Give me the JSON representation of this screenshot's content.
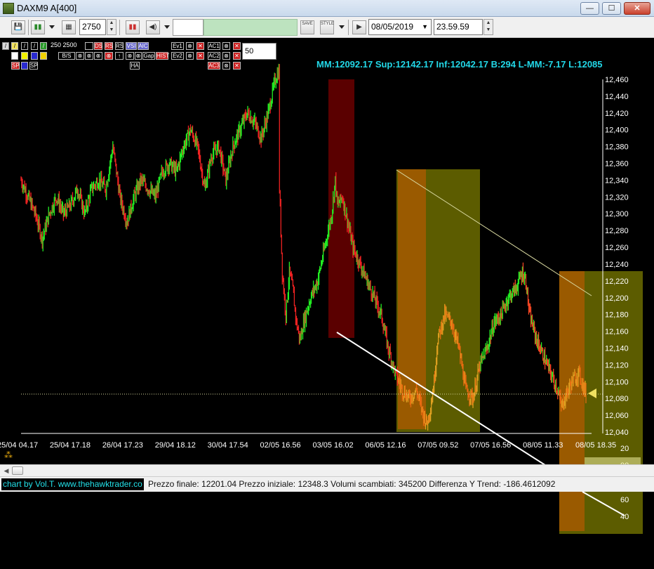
{
  "window": {
    "title": "DAXM9 A[400]",
    "min": "—",
    "max": "☐",
    "close": "✕"
  },
  "toolbar": {
    "quantity": "2750",
    "date": "08/05/2019",
    "time": "23.59.59",
    "save_label": "SAVE",
    "style_label": "STYLE"
  },
  "indicators": {
    "row1_nums": "250 2500",
    "row2": [
      "B/S",
      "VSI",
      "AIC",
      "Gap",
      "HIST",
      "Ev2",
      "AC2"
    ],
    "row1": [
      "DS",
      "RS",
      "RS",
      "VSI",
      "AIC",
      "Ev1",
      "AC1"
    ],
    "row3": [
      "SP",
      "SP",
      "HA",
      "AC3"
    ],
    "period": "50"
  },
  "info_line": "MM:12092.17 Sup:12142.17 Inf:12042.17 B:294 L-MM:-7.17 L:12085",
  "chart_data": {
    "type": "candlestick",
    "y_axis_labels": [
      "12,460",
      "12,440",
      "12,420",
      "12,400",
      "12,380",
      "12,360",
      "12,340",
      "12,320",
      "12,300",
      "12,280",
      "12,260",
      "12,240",
      "12,220",
      "12,200",
      "12,180",
      "12,160",
      "12,140",
      "12,120",
      "12,100",
      "12,080",
      "12,060",
      "12,040"
    ],
    "lower_axis_labels": [
      "20",
      "00",
      "80",
      "60",
      "40"
    ],
    "x_axis_labels": [
      "25/04 04.17",
      "25/04 17.18",
      "26/04 17.23",
      "29/04 18.12",
      "30/04 17.54",
      "02/05 16.56",
      "03/05 16.02",
      "06/05 12.16",
      "07/05 09.52",
      "07/05 16.56",
      "08/05 11.33",
      "08/05 18.35"
    ],
    "ylim": [
      12040,
      12460
    ],
    "last_price_level": 12085,
    "price_path": [
      [
        0,
        12340
      ],
      [
        10,
        12320
      ],
      [
        20,
        12300
      ],
      [
        30,
        12270
      ],
      [
        40,
        12300
      ],
      [
        50,
        12320
      ],
      [
        60,
        12300
      ],
      [
        70,
        12310
      ],
      [
        80,
        12330
      ],
      [
        90,
        12300
      ],
      [
        100,
        12330
      ],
      [
        110,
        12340
      ],
      [
        120,
        12330
      ],
      [
        130,
        12380
      ],
      [
        140,
        12320
      ],
      [
        150,
        12290
      ],
      [
        160,
        12320
      ],
      [
        170,
        12340
      ],
      [
        180,
        12330
      ],
      [
        190,
        12320
      ],
      [
        200,
        12350
      ],
      [
        210,
        12360
      ],
      [
        220,
        12350
      ],
      [
        230,
        12380
      ],
      [
        240,
        12400
      ],
      [
        250,
        12380
      ],
      [
        260,
        12330
      ],
      [
        270,
        12370
      ],
      [
        280,
        12380
      ],
      [
        290,
        12340
      ],
      [
        300,
        12380
      ],
      [
        310,
        12400
      ],
      [
        320,
        12420
      ],
      [
        330,
        12410
      ],
      [
        340,
        12390
      ],
      [
        350,
        12420
      ],
      [
        360,
        12460
      ],
      [
        365,
        12470
      ],
      [
        366,
        12330
      ],
      [
        370,
        12230
      ],
      [
        375,
        12180
      ],
      [
        380,
        12230
      ],
      [
        385,
        12210
      ],
      [
        390,
        12170
      ],
      [
        395,
        12150
      ],
      [
        400,
        12170
      ],
      [
        410,
        12200
      ],
      [
        420,
        12220
      ],
      [
        430,
        12260
      ],
      [
        440,
        12300
      ],
      [
        445,
        12340
      ],
      [
        448,
        12310
      ],
      [
        455,
        12320
      ],
      [
        460,
        12300
      ],
      [
        470,
        12260
      ],
      [
        480,
        12240
      ],
      [
        490,
        12220
      ],
      [
        500,
        12200
      ],
      [
        510,
        12180
      ],
      [
        520,
        12140
      ],
      [
        530,
        12110
      ],
      [
        540,
        12090
      ],
      [
        550,
        12080
      ],
      [
        560,
        12090
      ],
      [
        570,
        12060
      ],
      [
        575,
        12050
      ],
      [
        580,
        12070
      ],
      [
        585,
        12100
      ],
      [
        590,
        12150
      ],
      [
        600,
        12180
      ],
      [
        610,
        12170
      ],
      [
        620,
        12140
      ],
      [
        630,
        12090
      ],
      [
        640,
        12080
      ],
      [
        650,
        12120
      ],
      [
        660,
        12140
      ],
      [
        670,
        12170
      ],
      [
        680,
        12180
      ],
      [
        690,
        12200
      ],
      [
        700,
        12210
      ],
      [
        710,
        12230
      ],
      [
        715,
        12220
      ],
      [
        720,
        12180
      ],
      [
        730,
        12150
      ],
      [
        740,
        12130
      ],
      [
        750,
        12110
      ],
      [
        760,
        12090
      ],
      [
        765,
        12070
      ],
      [
        770,
        12080
      ],
      [
        780,
        12100
      ],
      [
        790,
        12110
      ],
      [
        800,
        12085
      ]
    ]
  },
  "statusbar": {
    "credit": "chart by Vol.T. www.thehawktrader.co",
    "text": "Prezzo finale: 12201.04 Prezzo iniziale: 12348.3 Volumi scambiati: 345200 Differenza Y Trend: -186.4612092"
  }
}
